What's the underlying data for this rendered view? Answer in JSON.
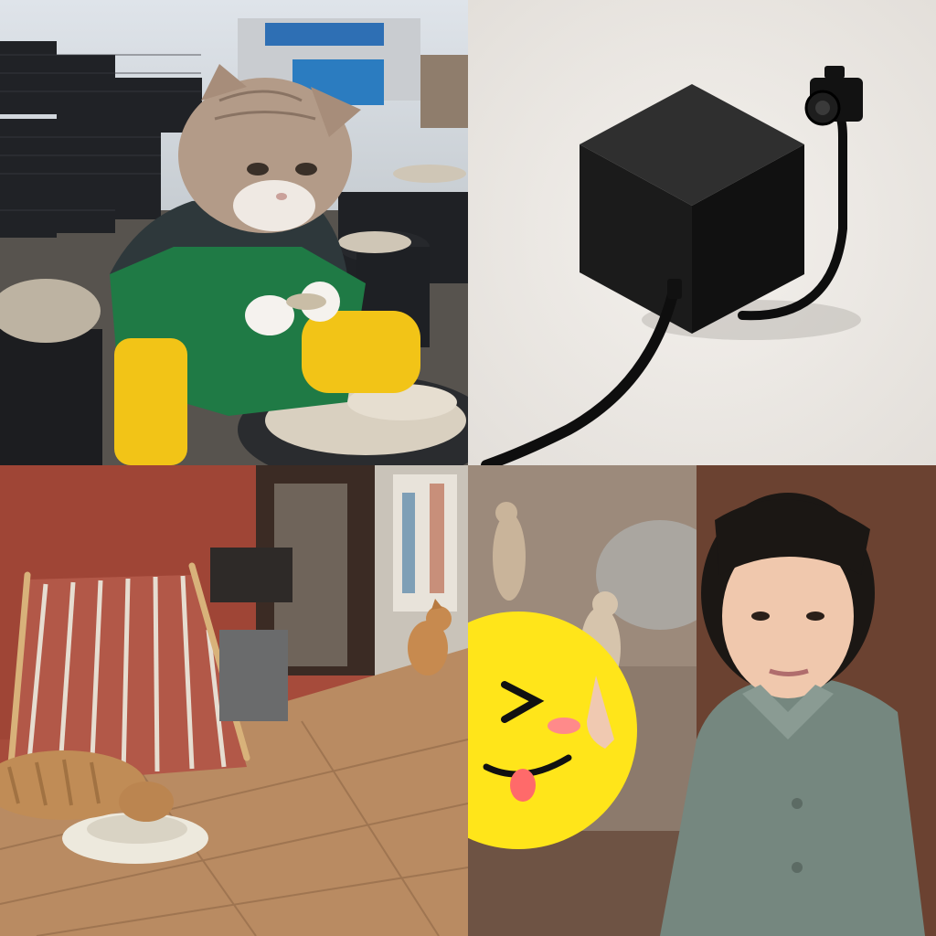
{
  "collage": {
    "panels": [
      {
        "subject": "cat-in-apron-shucking-oysters",
        "palette": {
          "bg": "#6b6a66",
          "apron": "#1f7a45",
          "boots": "#f2c417",
          "fur": "#b79a86"
        }
      },
      {
        "subject": "black-cube-with-cable-camera",
        "palette": {
          "bg": "#ece8e3",
          "object": "#171717"
        }
      },
      {
        "subject": "cats-by-striped-tent-on-sidewalk",
        "palette": {
          "wall": "#a64b3b",
          "stripe": "#b35b4e",
          "floor": "#b98b62",
          "cat": "#c48b53"
        }
      },
      {
        "subject": "person-pointing-at-meerkats",
        "palette": {
          "bg": "#6e5344",
          "shirt": "#75877f",
          "hair": "#1b1714",
          "emoji": "#ffe51a"
        }
      }
    ]
  },
  "photos": {
    "sign_text": "",
    "emoji": "smiley-emoji-sticker"
  }
}
